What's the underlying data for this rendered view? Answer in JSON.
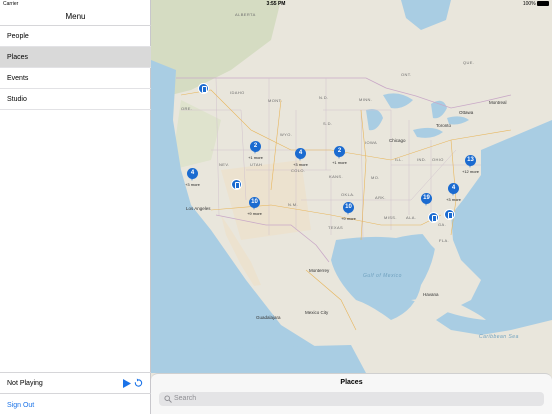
{
  "status_bar": {
    "carrier": "Carrier",
    "time": "3:55 PM",
    "battery": "100%"
  },
  "sidebar": {
    "title": "Menu",
    "items": [
      {
        "label": "People",
        "selected": false
      },
      {
        "label": "Places",
        "selected": true
      },
      {
        "label": "Events",
        "selected": false
      },
      {
        "label": "Studio",
        "selected": false
      }
    ],
    "player": {
      "status": "Not Playing"
    },
    "sign_out": "Sign Out"
  },
  "map": {
    "state_labels": [
      "MONT.",
      "N.D.",
      "S.D.",
      "NEB.",
      "WYO.",
      "UTAH",
      "COLO.",
      "NEV.",
      "N.M.",
      "TEXAS",
      "OKLA.",
      "ARK.",
      "MO.",
      "IOWA",
      "ILL.",
      "IND.",
      "OHIO",
      "MISS.",
      "ALA.",
      "GA.",
      "FLA.",
      "MINN.",
      "IDAHO",
      "ORE.",
      "KANS.",
      "ONT.",
      "QUE."
    ],
    "cities": [
      "Chicago",
      "Los Angeles",
      "Mexico City",
      "Havana",
      "Monterrey",
      "Guadalajara",
      "Ottawa",
      "Montreal",
      "Toronto"
    ],
    "water_labels": [
      "Gulf of Mexico",
      "Caribbean Sea"
    ],
    "clusters": [
      {
        "count": "2",
        "more": "+1 more"
      },
      {
        "count": "4",
        "more": "+3 more"
      },
      {
        "count": "2",
        "more": "+1 more"
      },
      {
        "count": "4",
        "more": "+3 more"
      },
      {
        "count": "10",
        "more": "+9 more"
      },
      {
        "count": "10",
        "more": "+9 more"
      },
      {
        "count": "19",
        "more": ""
      },
      {
        "count": "4",
        "more": "+3 more"
      },
      {
        "count": "13",
        "more": "+12 more"
      }
    ]
  },
  "sheet": {
    "title": "Places",
    "search_placeholder": "Search"
  },
  "colors": {
    "accent": "#1b6bd0",
    "link": "#1b73e8",
    "land": "#e9e6dc",
    "water": "#a9cde3",
    "selected": "#d9d9d9"
  }
}
